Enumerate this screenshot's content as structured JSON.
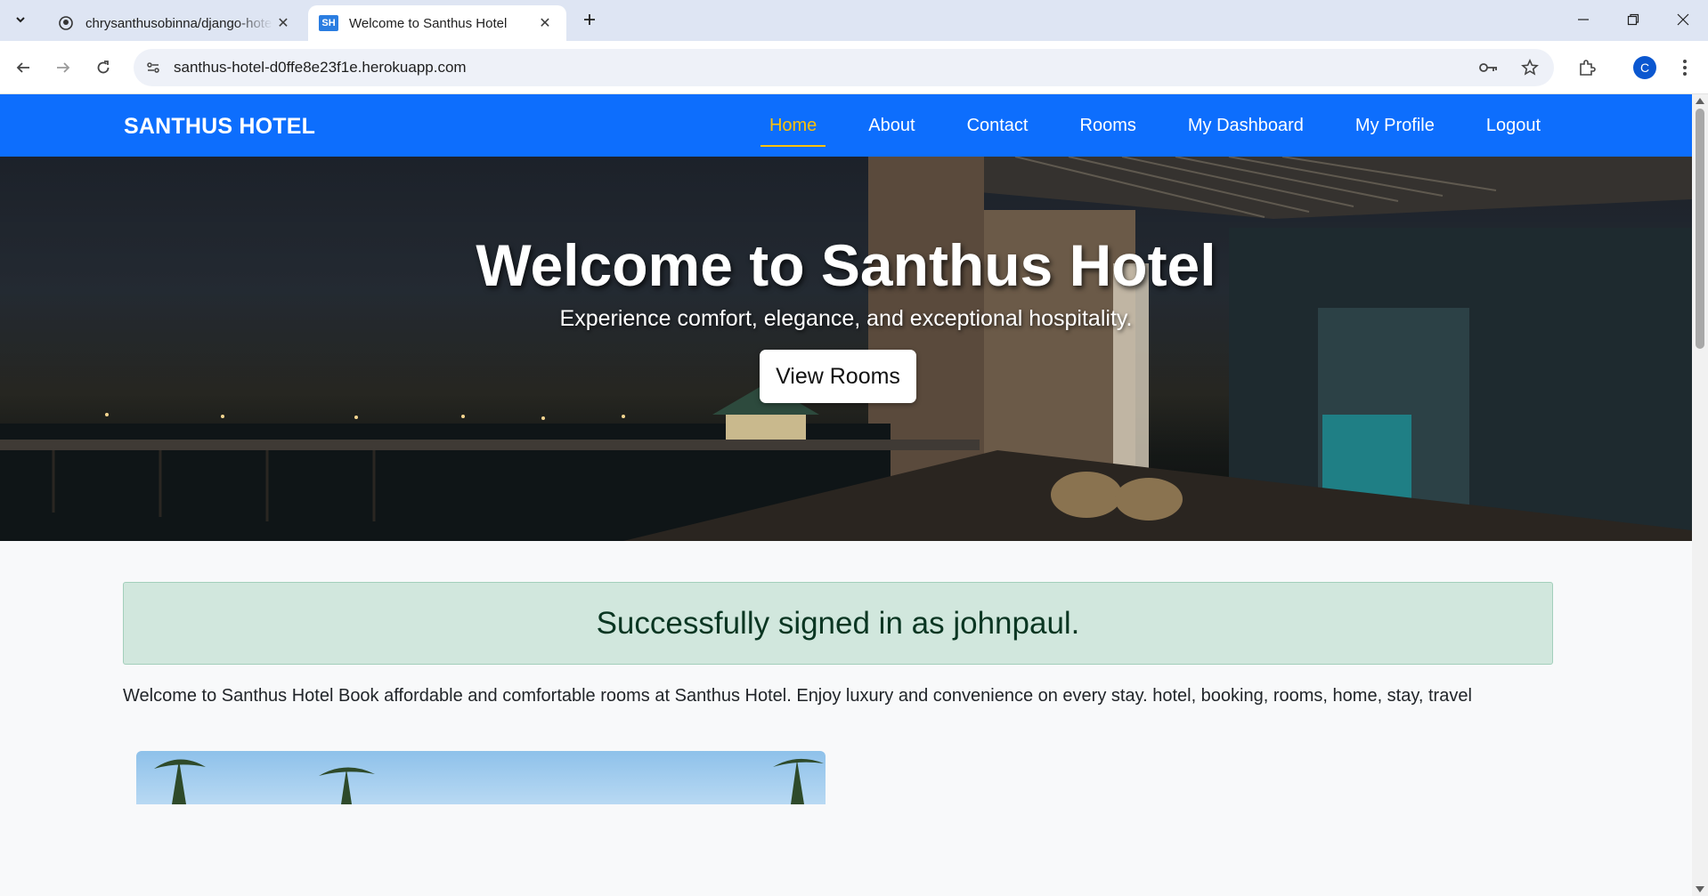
{
  "browser": {
    "tabs": [
      {
        "title": "chrysanthusobinna/django-hotel",
        "favicon": "github-icon",
        "active": false
      },
      {
        "title": "Welcome to Santhus Hotel",
        "favicon_text": "SH",
        "active": true
      }
    ],
    "url": "santhus-hotel-d0ffe8e23f1e.herokuapp.com",
    "profile_initial": "C"
  },
  "site": {
    "brand": "SANTHUS HOTEL",
    "nav": [
      {
        "label": "Home",
        "active": true
      },
      {
        "label": "About",
        "active": false
      },
      {
        "label": "Contact",
        "active": false
      },
      {
        "label": "Rooms",
        "active": false
      },
      {
        "label": "My Dashboard",
        "active": false
      },
      {
        "label": "My Profile",
        "active": false
      },
      {
        "label": "Logout",
        "active": false
      }
    ],
    "colors": {
      "navbar": "#0d6efd",
      "active_link": "#ffc107",
      "alert_bg": "#d1e7dd",
      "alert_text": "#0a3622"
    }
  },
  "hero": {
    "heading": "Welcome to Santhus Hotel",
    "subheading": "Experience comfort, elegance, and exceptional hospitality.",
    "button": "View Rooms"
  },
  "alert": {
    "message": "Successfully signed in as johnpaul."
  },
  "intro": "Welcome to Santhus Hotel Book affordable and comfortable rooms at Santhus Hotel. Enjoy luxury and convenience on every stay. hotel, booking, rooms, home, stay, travel"
}
